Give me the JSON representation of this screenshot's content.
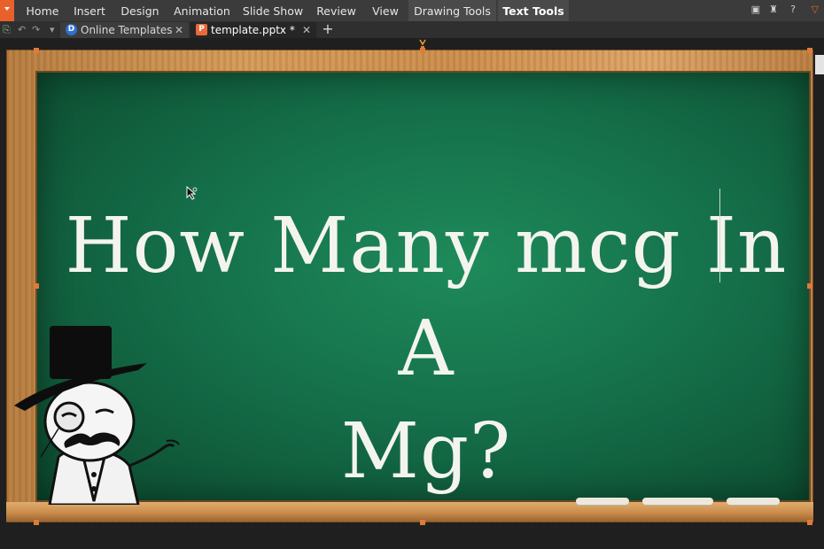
{
  "menu": {
    "items": [
      "Home",
      "Insert",
      "Design",
      "Animation",
      "Slide Show",
      "Review",
      "View",
      "Drawing Tools",
      "Text Tools"
    ],
    "active": "Text Tools"
  },
  "tabs": [
    {
      "label": "Online Templates",
      "icon": "D"
    },
    {
      "label": "template.pptx *",
      "icon": "P"
    }
  ],
  "slide": {
    "title_line1": "How Many mcg In A",
    "title_line2": "Mg?"
  },
  "colors": {
    "menu_bg": "#3b3b3b",
    "app_button": "#e8602c",
    "board_green": "#15704a",
    "frame_wood": "#c98c4a",
    "handle": "#e07a3a"
  },
  "icons": {
    "app": "app-menu-icon",
    "undo": "undo-icon",
    "redo": "redo-icon",
    "templates_tab": "online-templates-icon",
    "pptx_tab": "presentation-file-icon",
    "add_tab": "plus-icon",
    "character": "gentleman-meme-illustration"
  }
}
